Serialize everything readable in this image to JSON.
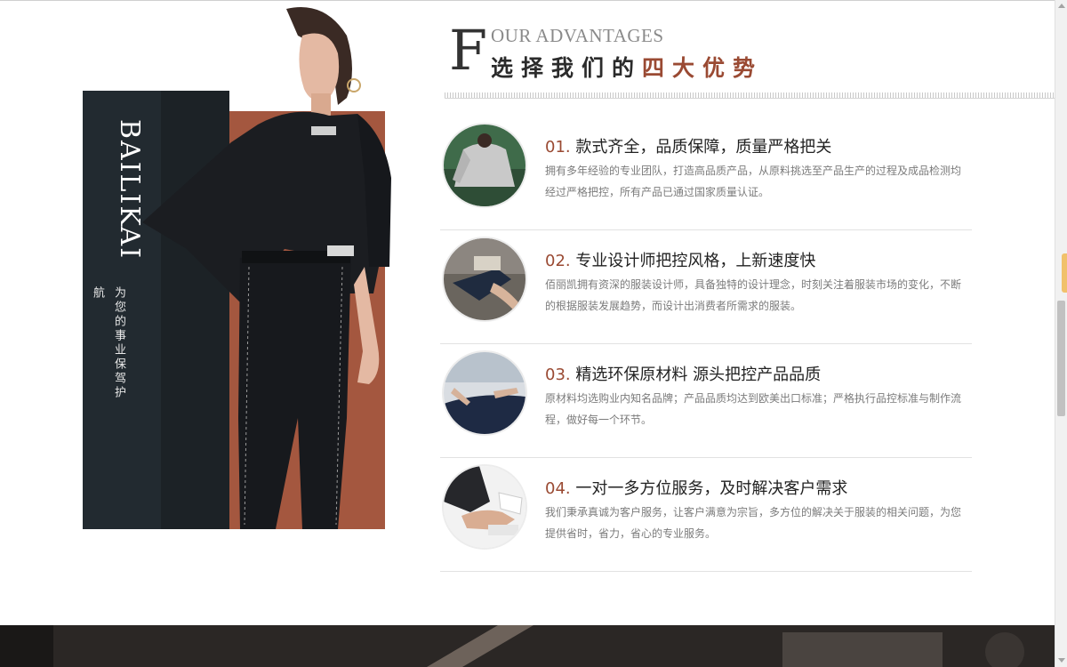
{
  "brand": {
    "name": "BAILIKAI",
    "slogan": "为您的事业保驾护航"
  },
  "section": {
    "big_letter": "F",
    "title_en": "OUR ADVANTAGES",
    "title_cn_prefix": "选择我们的",
    "title_cn_accent": "四大优势"
  },
  "advantages": [
    {
      "num": "01.",
      "title": "款式齐全，品质保障，质量严格把关",
      "desc": "拥有多年经验的专业团队，打造高品质产品，从原料挑选至产品生产的过程及成品检测均经过严格把控，所有产品已通过国家质量认证。",
      "icon": "sweater-photo-icon"
    },
    {
      "num": "02.",
      "title": "专业设计师把控风格，上新速度快",
      "desc": "佰丽凯拥有资深的服装设计师，具备独特的设计理念，时刻关注着服装市场的变化，不断的根据服装发展趋势，而设计出消费者所需求的服装。",
      "icon": "sewing-machine-photo-icon"
    },
    {
      "num": "03.",
      "title": "精选环保原材料 源头把控产品品质",
      "desc": "原材料均选购业内知名品牌；产品品质均达到欧美出口标准；严格执行品控标准与制作流程，做好每一个环节。",
      "icon": "fabric-cutting-photo-icon"
    },
    {
      "num": "04.",
      "title": "一对一多方位服务，及时解决客户需求",
      "desc": "我们秉承真诚为客户服务，让客户满意为宗旨，多方位的解决关于服装的相关问题，为您提供省时，省力，省心的专业服务。",
      "icon": "handshake-photo-icon"
    }
  ],
  "colors": {
    "accent": "#9a4a33",
    "dark_panel": "#222a30",
    "rust_panel": "#a4573f"
  }
}
